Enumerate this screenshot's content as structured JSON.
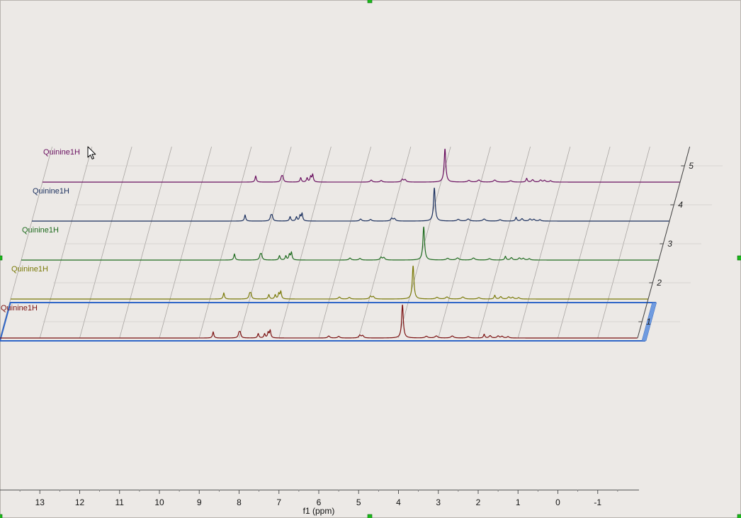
{
  "chart_data": {
    "type": "line",
    "chart_style": "stacked 3D (pseudo-perspective) NMR spectra",
    "xlabel": "f1 (ppm)",
    "xlim": [
      14.0,
      -2.0
    ],
    "x_reversed": true,
    "x_ticks": [
      13,
      12,
      11,
      10,
      9,
      8,
      7,
      6,
      5,
      4,
      3,
      2,
      1,
      0,
      -1
    ],
    "x_tick_labels": [
      "13",
      "12",
      "11",
      "10",
      "9",
      "8",
      "7",
      "6",
      "5",
      "4",
      "3",
      "2",
      "1",
      "0",
      "-1"
    ],
    "depth_ticks": [
      "1",
      "2",
      "3",
      "4",
      "5"
    ],
    "grid": true,
    "selected_trace": 1,
    "series": [
      {
        "name": "Quinine1H",
        "index": 1,
        "color": "#7a1010"
      },
      {
        "name": "Quinine1H",
        "index": 2,
        "color": "#7a7a08"
      },
      {
        "name": "Quinine1H",
        "index": 3,
        "color": "#1e6b1e"
      },
      {
        "name": "Quinine1H",
        "index": 4,
        "color": "#1a2f5e"
      },
      {
        "name": "Quinine1H",
        "index": 5,
        "color": "#6a1060"
      }
    ],
    "peaks": [
      {
        "ppm": 8.65,
        "height": 0.18,
        "width": 0.02
      },
      {
        "ppm": 8.0,
        "height": 0.15,
        "width": 0.025
      },
      {
        "ppm": 7.97,
        "height": 0.13,
        "width": 0.02
      },
      {
        "ppm": 7.52,
        "height": 0.13,
        "width": 0.02
      },
      {
        "ppm": 7.36,
        "height": 0.12,
        "width": 0.02
      },
      {
        "ppm": 7.27,
        "height": 0.16,
        "width": 0.02
      },
      {
        "ppm": 7.22,
        "height": 0.22,
        "width": 0.02
      },
      {
        "ppm": 5.75,
        "height": 0.06,
        "width": 0.03
      },
      {
        "ppm": 5.5,
        "height": 0.05,
        "width": 0.03
      },
      {
        "ppm": 4.97,
        "height": 0.08,
        "width": 0.03
      },
      {
        "ppm": 4.9,
        "height": 0.07,
        "width": 0.03
      },
      {
        "ppm": 3.9,
        "height": 1.0,
        "width": 0.025
      },
      {
        "ppm": 3.3,
        "height": 0.05,
        "width": 0.04
      },
      {
        "ppm": 3.05,
        "height": 0.06,
        "width": 0.04
      },
      {
        "ppm": 2.65,
        "height": 0.06,
        "width": 0.04
      },
      {
        "ppm": 2.25,
        "height": 0.04,
        "width": 0.04
      },
      {
        "ppm": 1.85,
        "height": 0.11,
        "width": 0.02
      },
      {
        "ppm": 1.7,
        "height": 0.07,
        "width": 0.03
      },
      {
        "ppm": 1.5,
        "height": 0.06,
        "width": 0.03
      },
      {
        "ppm": 1.4,
        "height": 0.05,
        "width": 0.03
      },
      {
        "ppm": 1.25,
        "height": 0.04,
        "width": 0.03
      }
    ]
  }
}
